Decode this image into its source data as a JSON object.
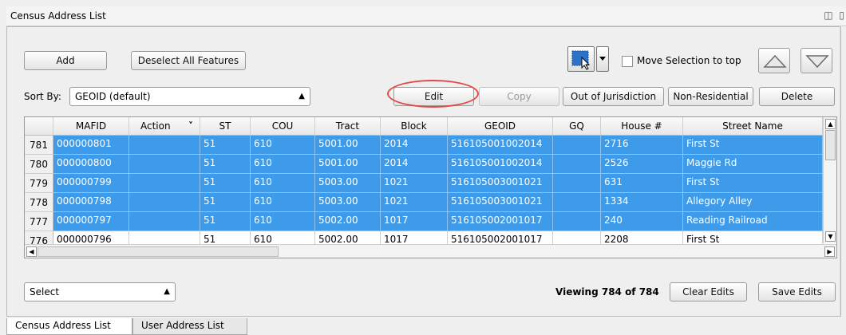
{
  "window": {
    "title": "Census Address List",
    "title_icons": "◫ ▯"
  },
  "toolbar": {
    "add_label": "Add",
    "deselect_label": "Deselect All Features",
    "move_selection_label": "Move Selection to top",
    "move_selection_checked": false
  },
  "sort": {
    "label": "Sort By:",
    "value": "GEOID (default)"
  },
  "actions": {
    "edit_label": "Edit",
    "copy_label": "Copy",
    "out_of_jurisdiction_label": "Out of Jurisdiction",
    "non_residential_label": "Non-Residential",
    "delete_label": "Delete"
  },
  "table": {
    "columns": [
      "MAFID",
      "Action",
      "ST",
      "COU",
      "Tract",
      "Block",
      "GEOID",
      "GQ",
      "House #",
      "Street Name"
    ],
    "action_sort_indicator": "˅",
    "rows": [
      {
        "num": "781",
        "selected": true,
        "cells": [
          "000000801",
          "",
          "51",
          "610",
          "5001.00",
          "2014",
          "516105001002014",
          "",
          "2716",
          "First St"
        ]
      },
      {
        "num": "780",
        "selected": true,
        "cells": [
          "000000800",
          "",
          "51",
          "610",
          "5001.00",
          "2014",
          "516105001002014",
          "",
          "2526",
          "Maggie Rd"
        ]
      },
      {
        "num": "779",
        "selected": true,
        "cells": [
          "000000799",
          "",
          "51",
          "610",
          "5003.00",
          "1021",
          "516105003001021",
          "",
          "631",
          "First St"
        ]
      },
      {
        "num": "778",
        "selected": true,
        "cells": [
          "000000798",
          "",
          "51",
          "610",
          "5003.00",
          "1021",
          "516105003001021",
          "",
          "1334",
          "Allegory Alley"
        ]
      },
      {
        "num": "777",
        "selected": true,
        "cells": [
          "000000797",
          "",
          "51",
          "610",
          "5002.00",
          "1017",
          "516105002001017",
          "",
          "240",
          "Reading Railroad"
        ]
      },
      {
        "num": "776",
        "selected": false,
        "cells": [
          "000000796",
          "",
          "51",
          "610",
          "5002.00",
          "1017",
          "516105002001017",
          "",
          "2208",
          "First St"
        ]
      }
    ]
  },
  "footer": {
    "select_value": "Select",
    "viewing_text": "Viewing 784 of 784",
    "clear_edits_label": "Clear Edits",
    "save_edits_label": "Save Edits"
  },
  "tabs": [
    {
      "label": "Census Address List",
      "active": true
    },
    {
      "label": "User Address List",
      "active": false
    }
  ],
  "colors": {
    "selection": "#3d9be9",
    "highlight_ellipse": "#e04a4a"
  }
}
